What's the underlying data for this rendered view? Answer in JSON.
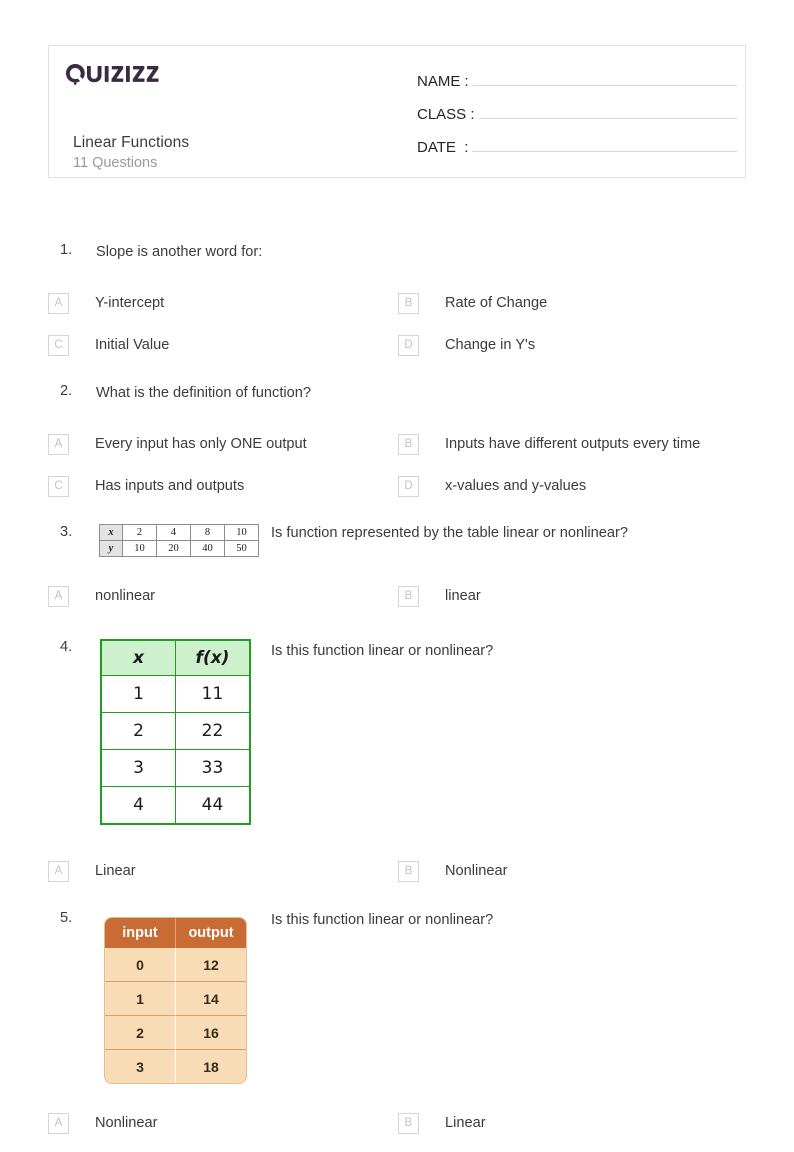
{
  "header": {
    "logo_text": "Quizizz",
    "logo_color": "#3b2a41",
    "quiz_title": "Linear Functions",
    "question_count": "11 Questions",
    "fields": [
      {
        "label": "NAME :"
      },
      {
        "label": "CLASS :"
      },
      {
        "label": "DATE  :"
      }
    ]
  },
  "questions": [
    {
      "number": "1.",
      "text": "Slope is another word for:",
      "options": [
        {
          "letter": "A",
          "label": "Y-intercept"
        },
        {
          "letter": "B",
          "label": "Rate of Change"
        },
        {
          "letter": "C",
          "label": "Initial Value"
        },
        {
          "letter": "D",
          "label": "Change in Y's"
        }
      ]
    },
    {
      "number": "2.",
      "text": "What is the definition of function?",
      "options": [
        {
          "letter": "A",
          "label": "Every input has only ONE output"
        },
        {
          "letter": "B",
          "label": "Inputs have different outputs every time"
        },
        {
          "letter": "C",
          "label": "Has inputs and outputs"
        },
        {
          "letter": "D",
          "label": "x-values and y-values"
        }
      ]
    },
    {
      "number": "3.",
      "text": "Is function represented by the table linear or nonlinear?",
      "table": {
        "type": "grey-xy",
        "rows": [
          {
            "head": "x",
            "cells": [
              "2",
              "4",
              "8",
              "10"
            ]
          },
          {
            "head": "y",
            "cells": [
              "10",
              "20",
              "40",
              "50"
            ]
          }
        ]
      },
      "options": [
        {
          "letter": "A",
          "label": "nonlinear"
        },
        {
          "letter": "B",
          "label": "linear"
        }
      ]
    },
    {
      "number": "4.",
      "text": "Is this function linear or nonlinear?",
      "table": {
        "type": "green",
        "headers": [
          "x",
          "f(x)"
        ],
        "rows": [
          [
            "1",
            "11"
          ],
          [
            "2",
            "22"
          ],
          [
            "3",
            "33"
          ],
          [
            "4",
            "44"
          ]
        ]
      },
      "options": [
        {
          "letter": "A",
          "label": "Linear"
        },
        {
          "letter": "B",
          "label": "Nonlinear"
        }
      ]
    },
    {
      "number": "5.",
      "text": "Is this function linear or nonlinear?",
      "table": {
        "type": "orange",
        "headers": [
          "input",
          "output"
        ],
        "rows": [
          [
            "0",
            "12"
          ],
          [
            "1",
            "14"
          ],
          [
            "2",
            "16"
          ],
          [
            "3",
            "18"
          ]
        ]
      },
      "options": [
        {
          "letter": "A",
          "label": "Nonlinear"
        },
        {
          "letter": "B",
          "label": "Linear"
        }
      ]
    }
  ]
}
